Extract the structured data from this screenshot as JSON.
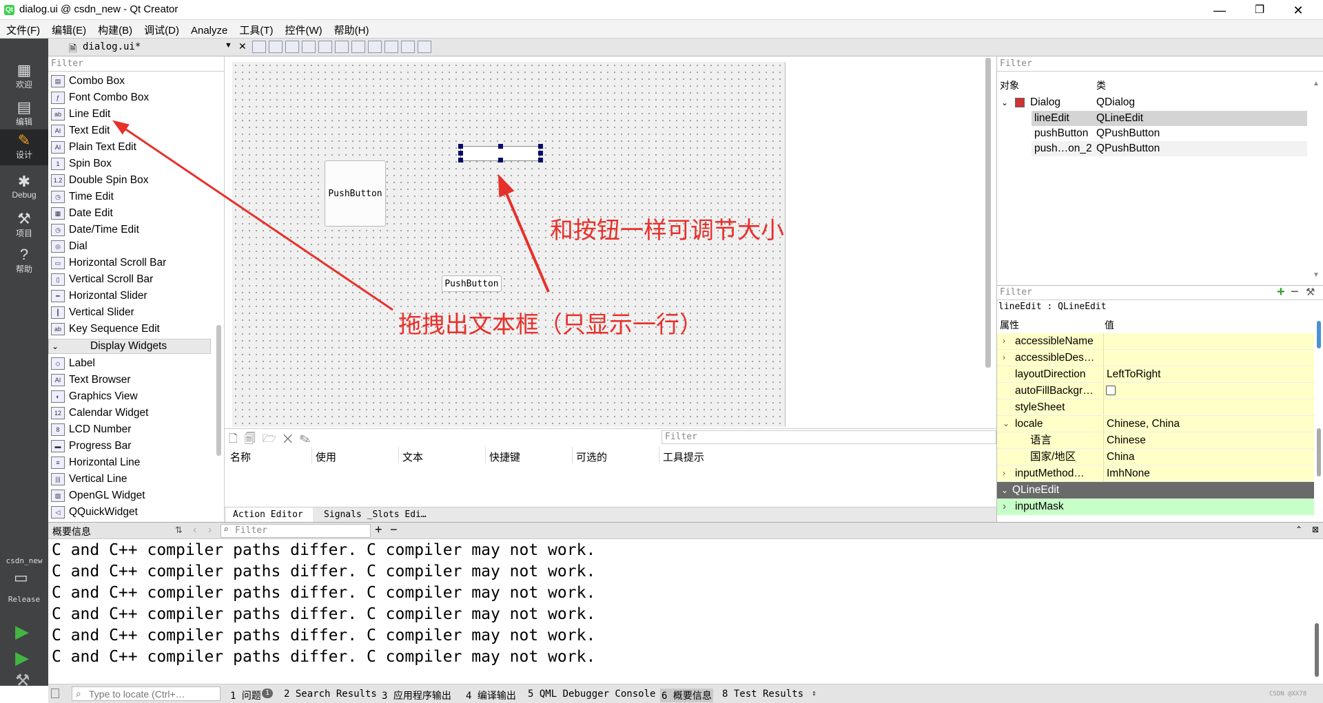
{
  "window": {
    "title": "dialog.ui @ csdn_new - Qt Creator",
    "minimize": "—",
    "maximize": "❐",
    "close": "✕",
    "app_icon": "qt-icon"
  },
  "menu": [
    "文件(F)",
    "编辑(E)",
    "构建(B)",
    "调试(D)",
    "Analyze",
    "工具(T)",
    "控件(W)",
    "帮助(H)"
  ],
  "modes": [
    {
      "label": "欢迎",
      "icon": "grid-icon"
    },
    {
      "label": "编辑",
      "icon": "edit-doc-icon"
    },
    {
      "label": "设计",
      "icon": "pencil-icon"
    },
    {
      "label": "Debug",
      "icon": "bug-icon"
    },
    {
      "label": "项目",
      "icon": "wrench-icon"
    },
    {
      "label": "帮助",
      "icon": "help-icon"
    }
  ],
  "kit": {
    "project": "csdn_new",
    "build": "Release"
  },
  "editor_tab": {
    "file": "dialog.ui*",
    "close": "✕"
  },
  "widget_box": {
    "filter_placeholder": "Filter",
    "input_items": [
      "Combo Box",
      "Font Combo Box",
      "Line Edit",
      "Text Edit",
      "Plain Text Edit",
      "Spin Box",
      "Double Spin Box",
      "Time Edit",
      "Date Edit",
      "Date/Time Edit",
      "Dial",
      "Horizontal Scroll Bar",
      "Vertical Scroll Bar",
      "Horizontal Slider",
      "Vertical Slider",
      "Key Sequence Edit"
    ],
    "display_category": "Display Widgets",
    "display_items": [
      "Label",
      "Text Browser",
      "Graphics View",
      "Calendar Widget",
      "LCD Number",
      "Progress Bar",
      "Horizontal Line",
      "Vertical Line",
      "OpenGL Widget",
      "QQuickWidget"
    ]
  },
  "form": {
    "button1": "PushButton",
    "button2": "PushButton"
  },
  "action_editor": {
    "filter": "Filter",
    "columns": [
      "名称",
      "使用",
      "文本",
      "快捷键",
      "可选的",
      "工具提示"
    ],
    "tabs": [
      "Action Editor",
      "Signals _Slots Edi…"
    ]
  },
  "object_inspector": {
    "filter": "Filter",
    "col_object": "对象",
    "col_class": "类",
    "rows": [
      {
        "name": "Dialog",
        "class": "QDialog"
      },
      {
        "name": "lineEdit",
        "class": "QLineEdit"
      },
      {
        "name": "pushButton",
        "class": "QPushButton"
      },
      {
        "name": "push…on_2",
        "class": "QPushButton"
      }
    ]
  },
  "property_editor": {
    "filter": "Filter",
    "header": "lineEdit : QLineEdit",
    "col_prop": "属性",
    "col_value": "值",
    "rows": [
      {
        "name": "accessibleName",
        "value": "",
        "exp": "›"
      },
      {
        "name": "accessibleDes…",
        "value": "",
        "exp": "›"
      },
      {
        "name": "layoutDirection",
        "value": "LeftToRight",
        "exp": ""
      },
      {
        "name": "autoFillBackgr…",
        "value": "",
        "exp": ""
      },
      {
        "name": "styleSheet",
        "value": "",
        "exp": ""
      },
      {
        "name": "locale",
        "value": "Chinese, China",
        "exp": "⌄"
      },
      {
        "name": "语言",
        "value": "Chinese",
        "exp": ""
      },
      {
        "name": "国家/地区",
        "value": "China",
        "exp": ""
      },
      {
        "name": "inputMethod…",
        "value": "ImhNone",
        "exp": "›"
      }
    ],
    "section": "QLineEdit",
    "input_mask": "inputMask"
  },
  "output": {
    "title": "概要信息",
    "filter": "Filter",
    "lines": [
      "C and C++ compiler paths differ. C compiler may not work.",
      "C and C++ compiler paths differ. C compiler may not work.",
      "C and C++ compiler paths differ. C compiler may not work.",
      "C and C++ compiler paths differ. C compiler may not work.",
      "C and C++ compiler paths differ. C compiler may not work.",
      "C and C++ compiler paths differ. C compiler may not work."
    ]
  },
  "statusbar": {
    "locate": "Type to locate (Ctrl+…",
    "tabs": [
      "1 问题",
      "2 Search Results",
      "3 应用程序输出",
      "4 编译输出",
      "5 QML Debugger Console",
      "6 概要信息",
      "8 Test Results"
    ],
    "issues_badge": "1",
    "watermark": "CSDN @XX78"
  },
  "annotations": {
    "resize": "和按钮一样可调节大小",
    "drag": "拖拽出文本框（只显示一行）"
  },
  "colors": {
    "annotation": "#e8302a",
    "modebar": "#404244",
    "property_row": "#ffffc8",
    "section_row": "#6a6a6a",
    "inputmask_row": "#c8ffc8"
  }
}
